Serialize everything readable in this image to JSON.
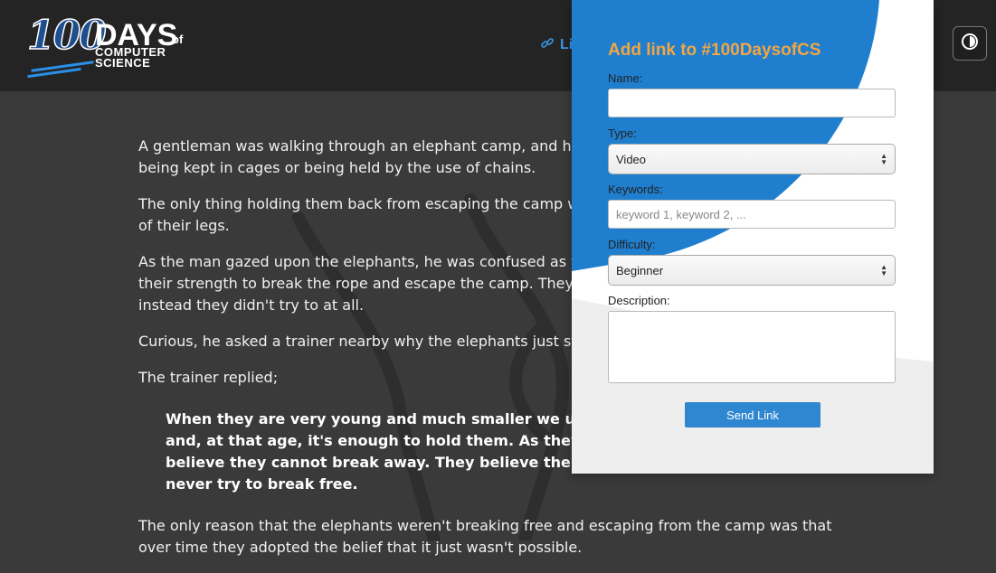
{
  "header": {
    "logo": {
      "number": "100",
      "days": "DAYS",
      "of": "of",
      "line1": "COMPUTER",
      "line2": "SCIENCE"
    },
    "nav_link_label": "Links",
    "nav_link_icon": "link-icon",
    "theme_toggle_icon": "contrast-icon"
  },
  "article": {
    "paragraphs": [
      "A gentleman was walking through an elephant camp, and he saw that the elephants weren't being kept in cages or being held by the use of chains.",
      "The only thing holding them back from escaping the camp was a small piece of rope tied to one of their legs.",
      "As the man gazed upon the elephants, he was confused as to why the elephants didn't just use their strength to break the rope and escape the camp. They could easily have done so, but instead they didn't try to at all.",
      "Curious, he asked a trainer nearby why the elephants just stood there and never tried to escape.",
      "The trainer replied;"
    ],
    "quote": "When they are very young and much smaller we use the same size rope to tie them and, at that age, it's enough to hold them. As they grow, they are conditioned to believe they cannot break away. They believe the rope can still hold them, so they never try to break free.",
    "closing": "The only reason that the elephants weren't breaking free and escaping from the camp was that over time they adopted the belief that it just wasn't possible."
  },
  "modal": {
    "title": "Add link to #100DaysofCS",
    "name_label": "Name:",
    "name_value": "",
    "type_label": "Type:",
    "type_value": "Video",
    "keywords_label": "Keywords:",
    "keywords_placeholder": "keyword 1, keyword 2, ...",
    "difficulty_label": "Difficulty:",
    "difficulty_value": "Beginner",
    "description_label": "Description:",
    "description_value": "",
    "send_label": "Send Link"
  },
  "colors": {
    "header_bg": "#242424",
    "page_bg": "#3a3a3a",
    "accent_blue": "#2f87d1",
    "title_orange": "#f2a644"
  }
}
